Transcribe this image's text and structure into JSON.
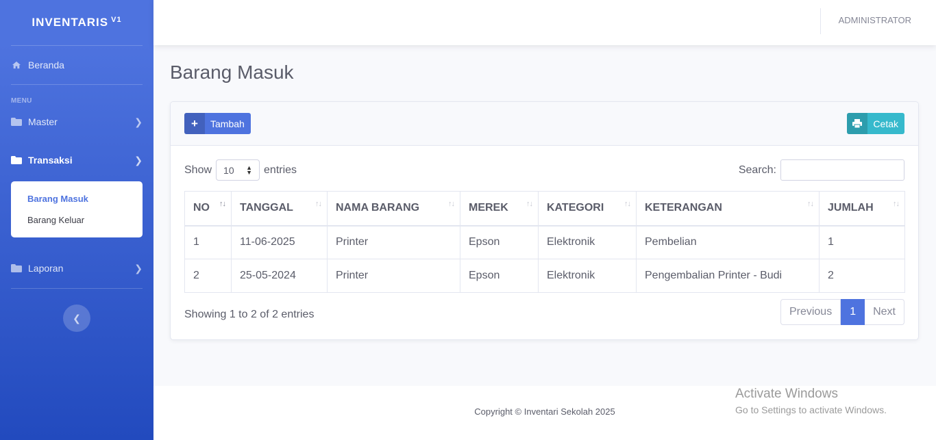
{
  "brand": {
    "name": "INVENTARIS",
    "version": "V1"
  },
  "sidebar": {
    "home": {
      "label": "Beranda",
      "icon": "home-icon"
    },
    "heading": "MENU",
    "items": [
      {
        "label": "Master",
        "icon": "folder-icon"
      },
      {
        "label": "Transaksi",
        "icon": "folder-icon"
      },
      {
        "label": "Laporan",
        "icon": "folder-icon"
      }
    ],
    "submenu": [
      {
        "label": "Barang Masuk"
      },
      {
        "label": "Barang Keluar"
      }
    ],
    "toggle_icon": "chevron-left-icon"
  },
  "topbar": {
    "user": "ADMINISTRATOR"
  },
  "page": {
    "title": "Barang Masuk"
  },
  "toolbar": {
    "add_label": "Tambah",
    "add_icon": "plus-icon",
    "print_label": "Cetak",
    "print_icon": "printer-icon"
  },
  "datatable": {
    "show_label": "Show",
    "entries_value": "10",
    "entries_label": "entries",
    "search_label": "Search:",
    "search_value": "",
    "columns": [
      "NO",
      "TANGGAL",
      "NAMA BARANG",
      "MEREK",
      "KATEGORI",
      "KETERANGAN",
      "JUMLAH"
    ],
    "rows": [
      [
        "1",
        "11-06-2025",
        "Printer",
        "Epson",
        "Elektronik",
        "Pembelian",
        "1"
      ],
      [
        "2",
        "25-05-2024",
        "Printer",
        "Epson",
        "Elektronik",
        "Pengembalian Printer - Budi",
        "2"
      ]
    ],
    "info": "Showing 1 to 2 of 2 entries",
    "pagination": {
      "previous": "Previous",
      "current": "1",
      "next": "Next"
    }
  },
  "footer": {
    "copyright": "Copyright © Inventari Sekolah 2025"
  },
  "watermark": {
    "line1": "Activate Windows",
    "line2": "Go to Settings to activate Windows."
  },
  "colors": {
    "primary": "#4e73df",
    "info": "#36b9cc",
    "sidebar_gradient_end": "#224abe"
  }
}
